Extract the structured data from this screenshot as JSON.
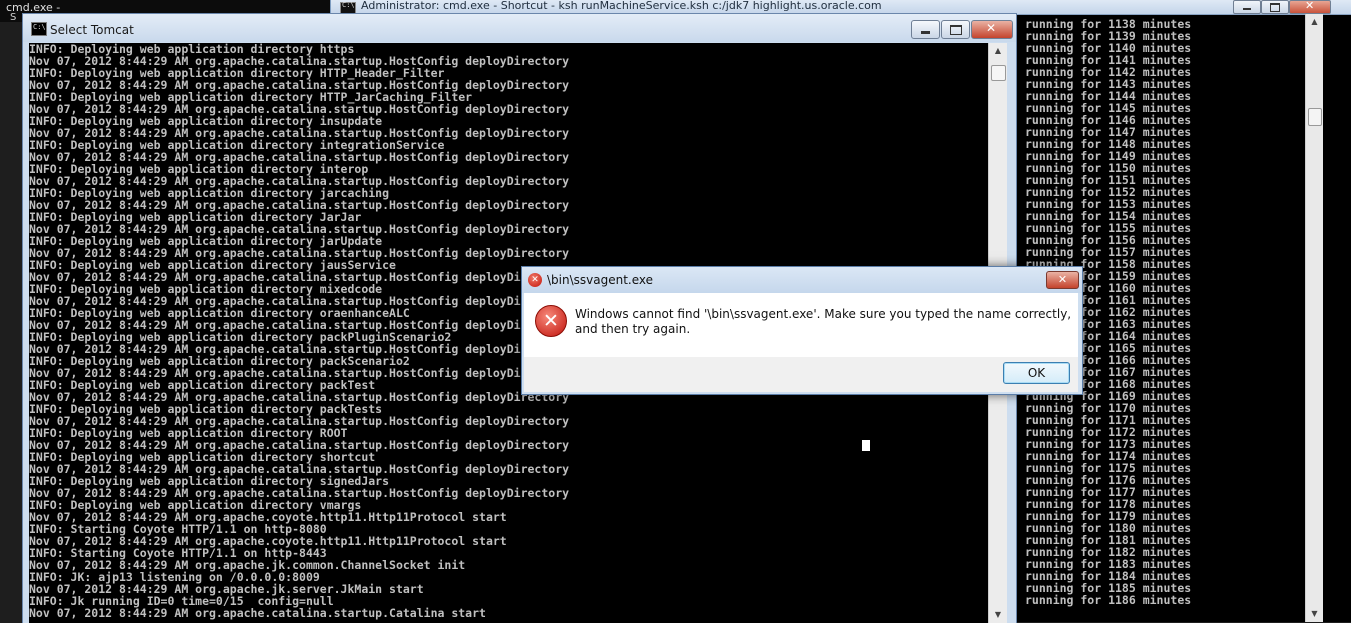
{
  "background_window": {
    "title": "cmd.exe -",
    "fragment": "S"
  },
  "right_window": {
    "title": "Administrator: cmd.exe - Shortcut - ksh  runMachineService.ksh c:/jdk7 highlight.us.oracle.com",
    "lines": [
      "running for 1138 minutes",
      "running for 1139 minutes",
      "running for 1140 minutes",
      "running for 1141 minutes",
      "running for 1142 minutes",
      "running for 1143 minutes",
      "running for 1144 minutes",
      "running for 1145 minutes",
      "running for 1146 minutes",
      "running for 1147 minutes",
      "running for 1148 minutes",
      "running for 1149 minutes",
      "running for 1150 minutes",
      "running for 1151 minutes",
      "running for 1152 minutes",
      "running for 1153 minutes",
      "running for 1154 minutes",
      "running for 1155 minutes",
      "running for 1156 minutes",
      "running for 1157 minutes",
      "running for 1158 minutes",
      "running for 1159 minutes",
      "running for 1160 minutes",
      "running for 1161 minutes",
      "running for 1162 minutes",
      "running for 1163 minutes",
      "running for 1164 minutes",
      "running for 1165 minutes",
      "running for 1166 minutes",
      "running for 1167 minutes",
      "running for 1168 minutes",
      "running for 1169 minutes",
      "running for 1170 minutes",
      "running for 1171 minutes",
      "running for 1172 minutes",
      "running for 1173 minutes",
      "running for 1174 minutes",
      "running for 1175 minutes",
      "running for 1176 minutes",
      "running for 1177 minutes",
      "running for 1178 minutes",
      "running for 1179 minutes",
      "running for 1180 minutes",
      "running for 1181 minutes",
      "running for 1182 minutes",
      "running for 1183 minutes",
      "running for 1184 minutes",
      "running for 1185 minutes",
      "running for 1186 minutes"
    ]
  },
  "left_window": {
    "title": "Select Tomcat",
    "lines": [
      "INFO: Deploying web application directory https",
      "Nov 07, 2012 8:44:29 AM org.apache.catalina.startup.HostConfig deployDirectory",
      "INFO: Deploying web application directory HTTP_Header_Filter",
      "Nov 07, 2012 8:44:29 AM org.apache.catalina.startup.HostConfig deployDirectory",
      "INFO: Deploying web application directory HTTP_JarCaching_Filter",
      "Nov 07, 2012 8:44:29 AM org.apache.catalina.startup.HostConfig deployDirectory",
      "INFO: Deploying web application directory insupdate",
      "Nov 07, 2012 8:44:29 AM org.apache.catalina.startup.HostConfig deployDirectory",
      "INFO: Deploying web application directory integrationService",
      "Nov 07, 2012 8:44:29 AM org.apache.catalina.startup.HostConfig deployDirectory",
      "INFO: Deploying web application directory interop",
      "Nov 07, 2012 8:44:29 AM org.apache.catalina.startup.HostConfig deployDirectory",
      "INFO: Deploying web application directory jarcaching",
      "Nov 07, 2012 8:44:29 AM org.apache.catalina.startup.HostConfig deployDirectory",
      "INFO: Deploying web application directory JarJar",
      "Nov 07, 2012 8:44:29 AM org.apache.catalina.startup.HostConfig deployDirectory",
      "INFO: Deploying web application directory jarUpdate",
      "Nov 07, 2012 8:44:29 AM org.apache.catalina.startup.HostConfig deployDirectory",
      "INFO: Deploying web application directory jausService",
      "Nov 07, 2012 8:44:29 AM org.apache.catalina.startup.HostConfig deployDirectory",
      "INFO: Deploying web application directory mixedcode",
      "Nov 07, 2012 8:44:29 AM org.apache.catalina.startup.HostConfig deployDirectory",
      "INFO: Deploying web application directory oraenhanceALC",
      "Nov 07, 2012 8:44:29 AM org.apache.catalina.startup.HostConfig deployDirectory",
      "INFO: Deploying web application directory packPluginScenario2",
      "Nov 07, 2012 8:44:29 AM org.apache.catalina.startup.HostConfig deployDirectory",
      "INFO: Deploying web application directory packScenario2",
      "Nov 07, 2012 8:44:29 AM org.apache.catalina.startup.HostConfig deployDirectory",
      "INFO: Deploying web application directory packTest",
      "Nov 07, 2012 8:44:29 AM org.apache.catalina.startup.HostConfig deployDirectory",
      "INFO: Deploying web application directory packTests",
      "Nov 07, 2012 8:44:29 AM org.apache.catalina.startup.HostConfig deployDirectory",
      "INFO: Deploying web application directory ROOT",
      "Nov 07, 2012 8:44:29 AM org.apache.catalina.startup.HostConfig deployDirectory",
      "INFO: Deploying web application directory shortcut",
      "Nov 07, 2012 8:44:29 AM org.apache.catalina.startup.HostConfig deployDirectory",
      "INFO: Deploying web application directory signedJars",
      "Nov 07, 2012 8:44:29 AM org.apache.catalina.startup.HostConfig deployDirectory",
      "INFO: Deploying web application directory vmargs",
      "Nov 07, 2012 8:44:29 AM org.apache.coyote.http11.Http11Protocol start",
      "INFO: Starting Coyote HTTP/1.1 on http-8080",
      "Nov 07, 2012 8:44:29 AM org.apache.coyote.http11.Http11Protocol start",
      "INFO: Starting Coyote HTTP/1.1 on http-8443",
      "Nov 07, 2012 8:44:29 AM org.apache.jk.common.ChannelSocket init",
      "INFO: JK: ajp13 listening on /0.0.0.0:8009",
      "Nov 07, 2012 8:44:29 AM org.apache.jk.server.JkMain start",
      "INFO: Jk running ID=0 time=0/15  config=null",
      "Nov 07, 2012 8:44:29 AM org.apache.catalina.startup.Catalina start"
    ]
  },
  "dialog": {
    "title": "\\bin\\ssvagent.exe",
    "message": "Windows cannot find '\\bin\\ssvagent.exe'. Make sure you typed the name correctly, and then try again.",
    "ok_label": "OK",
    "close_glyph": "✕",
    "error_glyph": "✕",
    "colors": {
      "error_red": "#c4140a",
      "button_border": "#3c7fb1"
    }
  },
  "icons": {
    "window_icon": "cmd-console-icon",
    "dialog_icon": "error-icon"
  }
}
